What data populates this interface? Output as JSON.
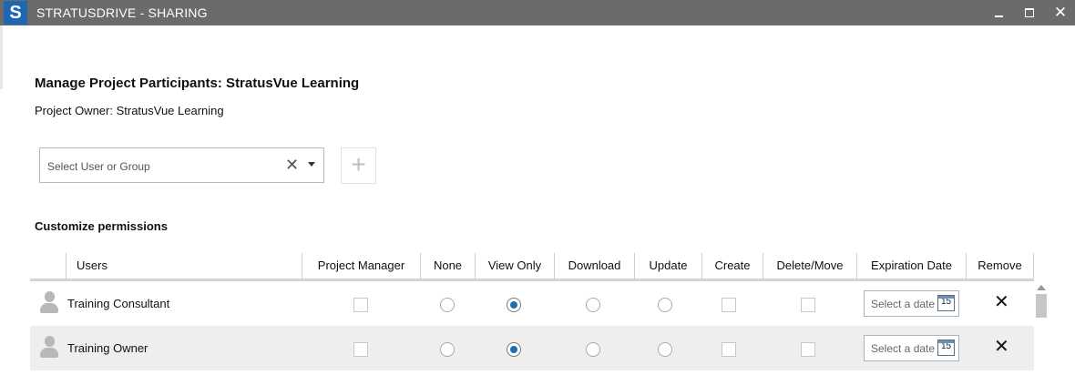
{
  "window": {
    "logo_letter": "S",
    "title": "STRATUSDRIVE - SHARING",
    "minimize_icon": "minimize-icon",
    "maximize_icon": "maximize-icon",
    "close_glyph": "✕"
  },
  "header": {
    "title": "Manage Project Participants: StratusVue Learning",
    "owner": "Project Owner: StratusVue Learning"
  },
  "user_select": {
    "placeholder": "Select User or Group",
    "clear_glyph": "✕",
    "add_glyph": "+"
  },
  "permissions": {
    "title": "Customize permissions",
    "columns": [
      "Users",
      "Project Manager",
      "None",
      "View Only",
      "Download",
      "Update",
      "Create",
      "Delete/Move",
      "Expiration Date",
      "Remove"
    ],
    "rows": [
      {
        "user": "Training Consultant",
        "project_manager": false,
        "access_level": "View Only",
        "create": false,
        "delete_move": false,
        "expiration_placeholder": "Select a date",
        "calendar_day": "15",
        "remove_glyph": "✕"
      },
      {
        "user": "Training Owner",
        "project_manager": false,
        "access_level": "View Only",
        "create": false,
        "delete_move": false,
        "expiration_placeholder": "Select a date",
        "calendar_day": "15",
        "remove_glyph": "✕"
      }
    ]
  },
  "colors": {
    "titlebar": "#6b6b6b",
    "logo_bg": "#1f66b3",
    "radio_selected": "#1e6fb0",
    "alt_row": "#eeeeee"
  }
}
